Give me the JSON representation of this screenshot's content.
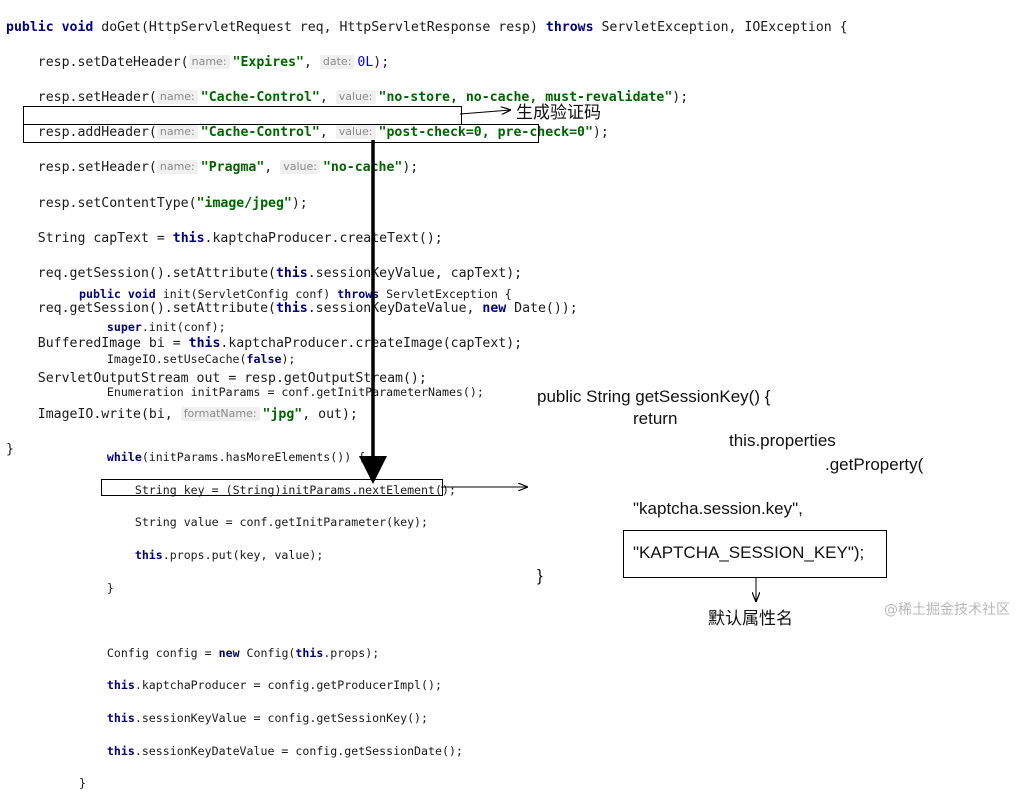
{
  "doget": {
    "l1_kw1": "public void ",
    "l1_rest": "doGet(HttpServletRequest req, HttpServletResponse resp) ",
    "l1_kw2": "throws",
    "l1_tail": " ServletException, IOException {",
    "l2_a": "resp.setDateHeader(",
    "l2_hint1": "name:",
    "l2_str": "\"Expires\"",
    "l2_sep": ", ",
    "l2_hint2": "date:",
    "l2_num": "0L",
    "l2_end": ");",
    "l3_a": "resp.setHeader(",
    "l3_hint1": "name:",
    "l3_str1": "\"Cache-Control\"",
    "l3_sep": ", ",
    "l3_hint2": "value:",
    "l3_str2": "\"no-store, no-cache, must-revalidate\"",
    "l3_end": ");",
    "l4_a": "resp.addHeader(",
    "l4_hint1": "name:",
    "l4_str1": "\"Cache-Control\"",
    "l4_sep": ", ",
    "l4_hint2": "value:",
    "l4_str2": "\"post-check=0, pre-check=0\"",
    "l4_end": ");",
    "l5_a": "resp.setHeader(",
    "l5_hint1": "name:",
    "l5_str1": "\"Pragma\"",
    "l5_sep": ", ",
    "l5_hint2": "value:",
    "l5_str2": "\"no-cache\"",
    "l5_end": ");",
    "l6_a": "resp.setContentType(",
    "l6_str": "\"image/jpeg\"",
    "l6_end": ");",
    "l7_a": "String capText = ",
    "l7_kw": "this",
    "l7_b": ".kaptchaProducer.createText();",
    "l8_a": "req.getSession().setAttribute(",
    "l8_kw": "this",
    "l8_b": ".sessionKeyValue, capText);",
    "l9_a": "req.getSession().setAttribute(",
    "l9_kw1": "this",
    "l9_b": ".sessionKeyDateValue, ",
    "l9_kw2": "new",
    "l9_c": " Date());",
    "l10_a": "BufferedImage bi = ",
    "l10_kw": "this",
    "l10_b": ".kaptchaProducer.createImage(capText);",
    "l11": "ServletOutputStream out = resp.getOutputStream();",
    "l12_a": "ImageIO.write(bi, ",
    "l12_hint": "formatName:",
    "l12_str": "\"jpg\"",
    "l12_end": ", out);",
    "l13": "}"
  },
  "init": {
    "l1_kw1": "public void ",
    "l1_rest": "init(ServletConfig conf) ",
    "l1_kw2": "throws",
    "l1_tail": " ServletException {",
    "l2_kw": "super",
    "l2_rest": ".init(conf);",
    "l3_a": "ImageIO.setUseCache(",
    "l3_kw": "false",
    "l3_end": ");",
    "l4": "Enumeration initParams = conf.getInitParameterNames();",
    "l5_kw": "while",
    "l5_rest": "(initParams.hasMoreElements()) {",
    "l6": "String key = (String)initParams.nextElement();",
    "l7": "String value = conf.getInitParameter(key);",
    "l8_kw": "this",
    "l8_rest": ".props.put(key, value);",
    "l9": "}",
    "l10_a": "Config config = ",
    "l10_kw1": "new",
    "l10_b": " Config(",
    "l10_kw2": "this",
    "l10_c": ".props);",
    "l11_kw": "this",
    "l11_rest": ".kaptchaProducer = config.getProducerImpl();",
    "l12_kw": "this",
    "l12_rest": ".sessionKeyValue = config.getSessionKey();",
    "l13_kw": "this",
    "l13_rest": ".sessionKeyDateValue = config.getSessionDate();",
    "l14": "}"
  },
  "annotations": {
    "generate_captcha": "生成验证码",
    "default_attr_name": "默认属性名"
  },
  "getter": {
    "l1": "public String getSessionKey() {",
    "l2": "return",
    "l3": "this.properties",
    "l4": ".getProperty(",
    "l5": "\"kaptcha.session.key\",",
    "l6": "\"KAPTCHA_SESSION_KEY\");",
    "l7": "}"
  },
  "watermark": "@稀土掘金技术社区"
}
